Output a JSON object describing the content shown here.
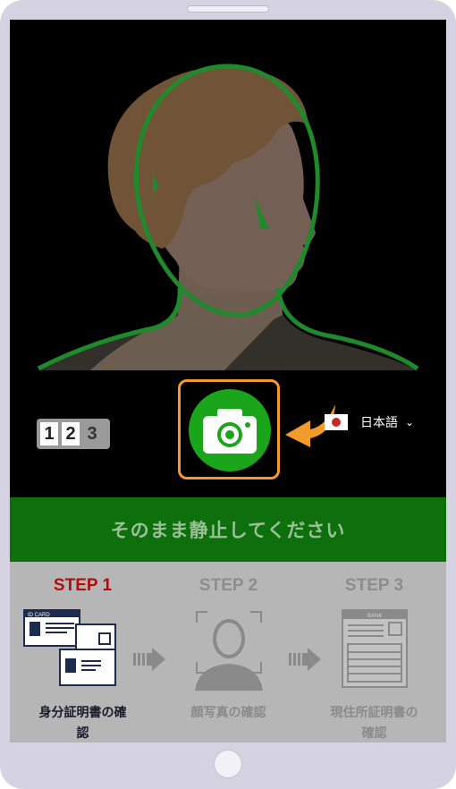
{
  "controls": {
    "counter": [
      "1",
      "2",
      "3"
    ],
    "language_label": "日本語"
  },
  "banner": {
    "text": "そのまま静止してください"
  },
  "steps": [
    {
      "title": "STEP 1",
      "caption_line1": "身分証明書の確",
      "caption_line2": "認",
      "card_label": "ID CARD",
      "active": true
    },
    {
      "title": "STEP 2",
      "caption_line1": "顔写真の確認",
      "caption_line2": "",
      "active": false
    },
    {
      "title": "STEP 3",
      "caption_line1": "現住所証明書の",
      "caption_line2": "確認",
      "doc_label": "BANK",
      "active": false
    }
  ],
  "colors": {
    "accent_orange": "#f29b2c",
    "shutter_green": "#1aa51a",
    "banner_green": "#0d700d",
    "active_step": "#b20d0d",
    "guide_outline": "#1f8a2c"
  }
}
